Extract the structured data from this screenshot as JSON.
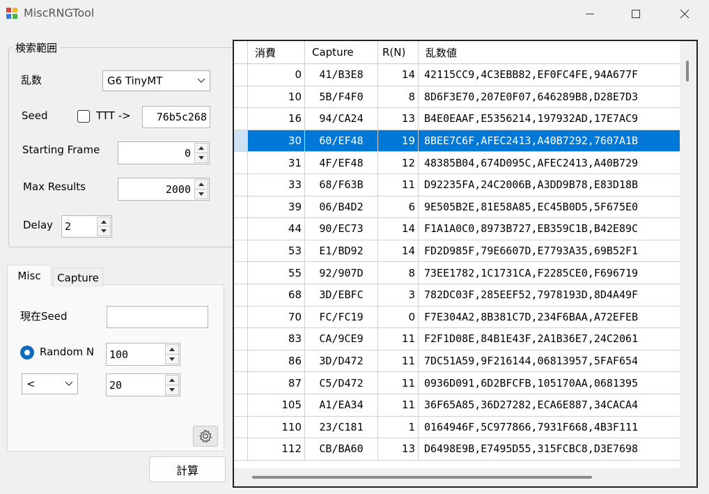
{
  "window": {
    "title": "MiscRNGTool"
  },
  "search_group": {
    "title": "検索範囲",
    "rng_label": "乱数",
    "rng_selected": "G6 TinyMT",
    "seed_label": "Seed",
    "ttt_label": "TTT ->",
    "ttt_checked": false,
    "seed_value": "76b5c268",
    "starting_frame_label": "Starting Frame",
    "starting_frame_value": "0",
    "max_results_label": "Max Results",
    "max_results_value": "2000",
    "delay_label": "Delay",
    "delay_value": "2"
  },
  "tabs": {
    "misc": "Misc",
    "capture": "Capture"
  },
  "misc_tab": {
    "current_seed_label": "現在Seed",
    "current_seed_value": "",
    "random_n_label": "Random N",
    "random_n_selected": true,
    "random_n_value": "100",
    "compare_selected": "<",
    "compare_value": "20"
  },
  "calc_button": "計算",
  "icons": {
    "app": "app-icon",
    "settings": "gear-icon",
    "dropdown": "chevron-down-icon",
    "spin_up": "spin-up-icon",
    "spin_down": "spin-down-icon"
  },
  "colors": {
    "selection": "#0078d7",
    "radio": "#0f6cbd"
  },
  "grid": {
    "columns": [
      "消費",
      "Capture",
      "R(N)",
      "乱数値"
    ],
    "rows": [
      {
        "frame": "0",
        "capture": "41/B3E8",
        "rn": "14",
        "rand": "42115CC9,4C3EBB82,EF0FC4FE,94A677F"
      },
      {
        "frame": "10",
        "capture": "5B/F4F0",
        "rn": "8",
        "rand": "8D6F3E70,207E0F07,646289B8,D28E7D3"
      },
      {
        "frame": "16",
        "capture": "94/CA24",
        "rn": "13",
        "rand": "B4E0EAAF,E5356214,197932AD,17E7AC9"
      },
      {
        "frame": "30",
        "capture": "60/EF48",
        "rn": "19",
        "rand": "8BEE7C6F,AFEC2413,A40B7292,7607A1B",
        "selected": true
      },
      {
        "frame": "31",
        "capture": "4F/EF48",
        "rn": "12",
        "rand": "48385B04,674D095C,AFEC2413,A40B729"
      },
      {
        "frame": "33",
        "capture": "68/F63B",
        "rn": "11",
        "rand": "D92235FA,24C2006B,A3DD9B78,E83D18B"
      },
      {
        "frame": "39",
        "capture": "06/B4D2",
        "rn": "6",
        "rand": "9E505B2E,81E58A85,EC45B0D5,5F675E0"
      },
      {
        "frame": "44",
        "capture": "90/EC73",
        "rn": "14",
        "rand": "F1A1A0C0,8973B727,EB359C1B,B42E89C"
      },
      {
        "frame": "53",
        "capture": "E1/BD92",
        "rn": "14",
        "rand": "FD2D985F,79E6607D,E7793A35,69B52F1"
      },
      {
        "frame": "55",
        "capture": "92/907D",
        "rn": "8",
        "rand": "73EE1782,1C1731CA,F2285CE0,F696719"
      },
      {
        "frame": "68",
        "capture": "3D/EBFC",
        "rn": "3",
        "rand": "782DC03F,285EEF52,7978193D,8D4A49F"
      },
      {
        "frame": "70",
        "capture": "FC/FC19",
        "rn": "0",
        "rand": "F7E304A2,8B381C7D,234F6BAA,A72EFEB"
      },
      {
        "frame": "83",
        "capture": "CA/9CE9",
        "rn": "11",
        "rand": "F2F1D08E,84B1E43F,2A1B36E7,24C2061"
      },
      {
        "frame": "86",
        "capture": "3D/D472",
        "rn": "11",
        "rand": "7DC51A59,9F216144,06813957,5FAF654"
      },
      {
        "frame": "87",
        "capture": "C5/D472",
        "rn": "11",
        "rand": "0936D091,6D2BFCFB,105170AA,0681395"
      },
      {
        "frame": "105",
        "capture": "A1/EA34",
        "rn": "11",
        "rand": "36F65A85,36D27282,ECA6E887,34CACA4"
      },
      {
        "frame": "110",
        "capture": "23/C181",
        "rn": "1",
        "rand": "0164946F,5C977866,7931F668,4B3F111"
      },
      {
        "frame": "112",
        "capture": "CB/BA60",
        "rn": "13",
        "rand": "D6498E9B,E7495D55,315FCBC8,D3E7698"
      }
    ]
  }
}
